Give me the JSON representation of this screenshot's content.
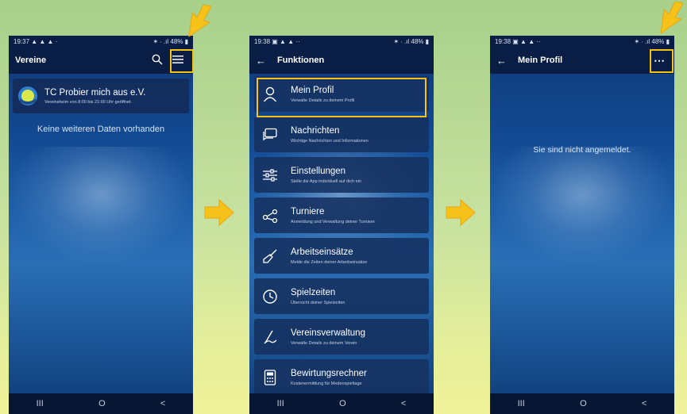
{
  "colors": {
    "accent": "#f6c21a",
    "appbar": "#0a1d44",
    "card": "#16325e"
  },
  "screen1": {
    "status_time": "19:37",
    "status_dots": "▲ ▲ ▲ ·",
    "status_right": "✶ ∙ .ıl 48% ▮",
    "title": "Vereine",
    "club_name": "TC Probier mich aus e.V.",
    "club_hours": "Vereinsheim von 8:00 bis 21:00 Uhr geöffnet.",
    "no_data": "Keine weiteren Daten vorhanden",
    "icons": [
      "search-icon",
      "menu-icon"
    ]
  },
  "screen2": {
    "status_time": "19:38",
    "status_dots": "▣ ▲ ▲ ··",
    "status_right": "✶ ∙ .ıl 48% ▮",
    "title": "Funktionen",
    "items": [
      {
        "label": "Mein Profil",
        "desc": "Verwalte Details zu deinem Profil",
        "icon": "person-icon"
      },
      {
        "label": "Nachrichten",
        "desc": "Wichtige Nachrichten und Informationen",
        "icon": "message-icon"
      },
      {
        "label": "Einstellungen",
        "desc": "Stelle die App individuell auf dich ein",
        "icon": "sliders-icon"
      },
      {
        "label": "Turniere",
        "desc": "Anmeldung und Verwaltung deiner Turniere",
        "icon": "share-icon"
      },
      {
        "label": "Arbeitseinsätze",
        "desc": "Melde die Zeiten deiner Arbeitseinsätze",
        "icon": "broom-icon"
      },
      {
        "label": "Spielzeiten",
        "desc": "Übersicht deiner Spielzeiten",
        "icon": "clock-icon"
      },
      {
        "label": "Vereinsverwaltung",
        "desc": "Verwalte Details zu deinem Verein",
        "icon": "signature-icon"
      },
      {
        "label": "Bewirtungsrechner",
        "desc": "Kostenermittlung für Medenspieltage",
        "icon": "calculator-icon"
      }
    ]
  },
  "screen3": {
    "status_time": "19:38",
    "status_dots": "▣ ▲ ▲ ··",
    "status_right": "✶ ∙ .ıl 48% ▮",
    "title": "Mein Profil",
    "not_logged_in": "Sie sind nicht angemeldet.",
    "more": "⋯"
  },
  "navbar": {
    "recents": "III",
    "home": "O",
    "back": "<"
  }
}
